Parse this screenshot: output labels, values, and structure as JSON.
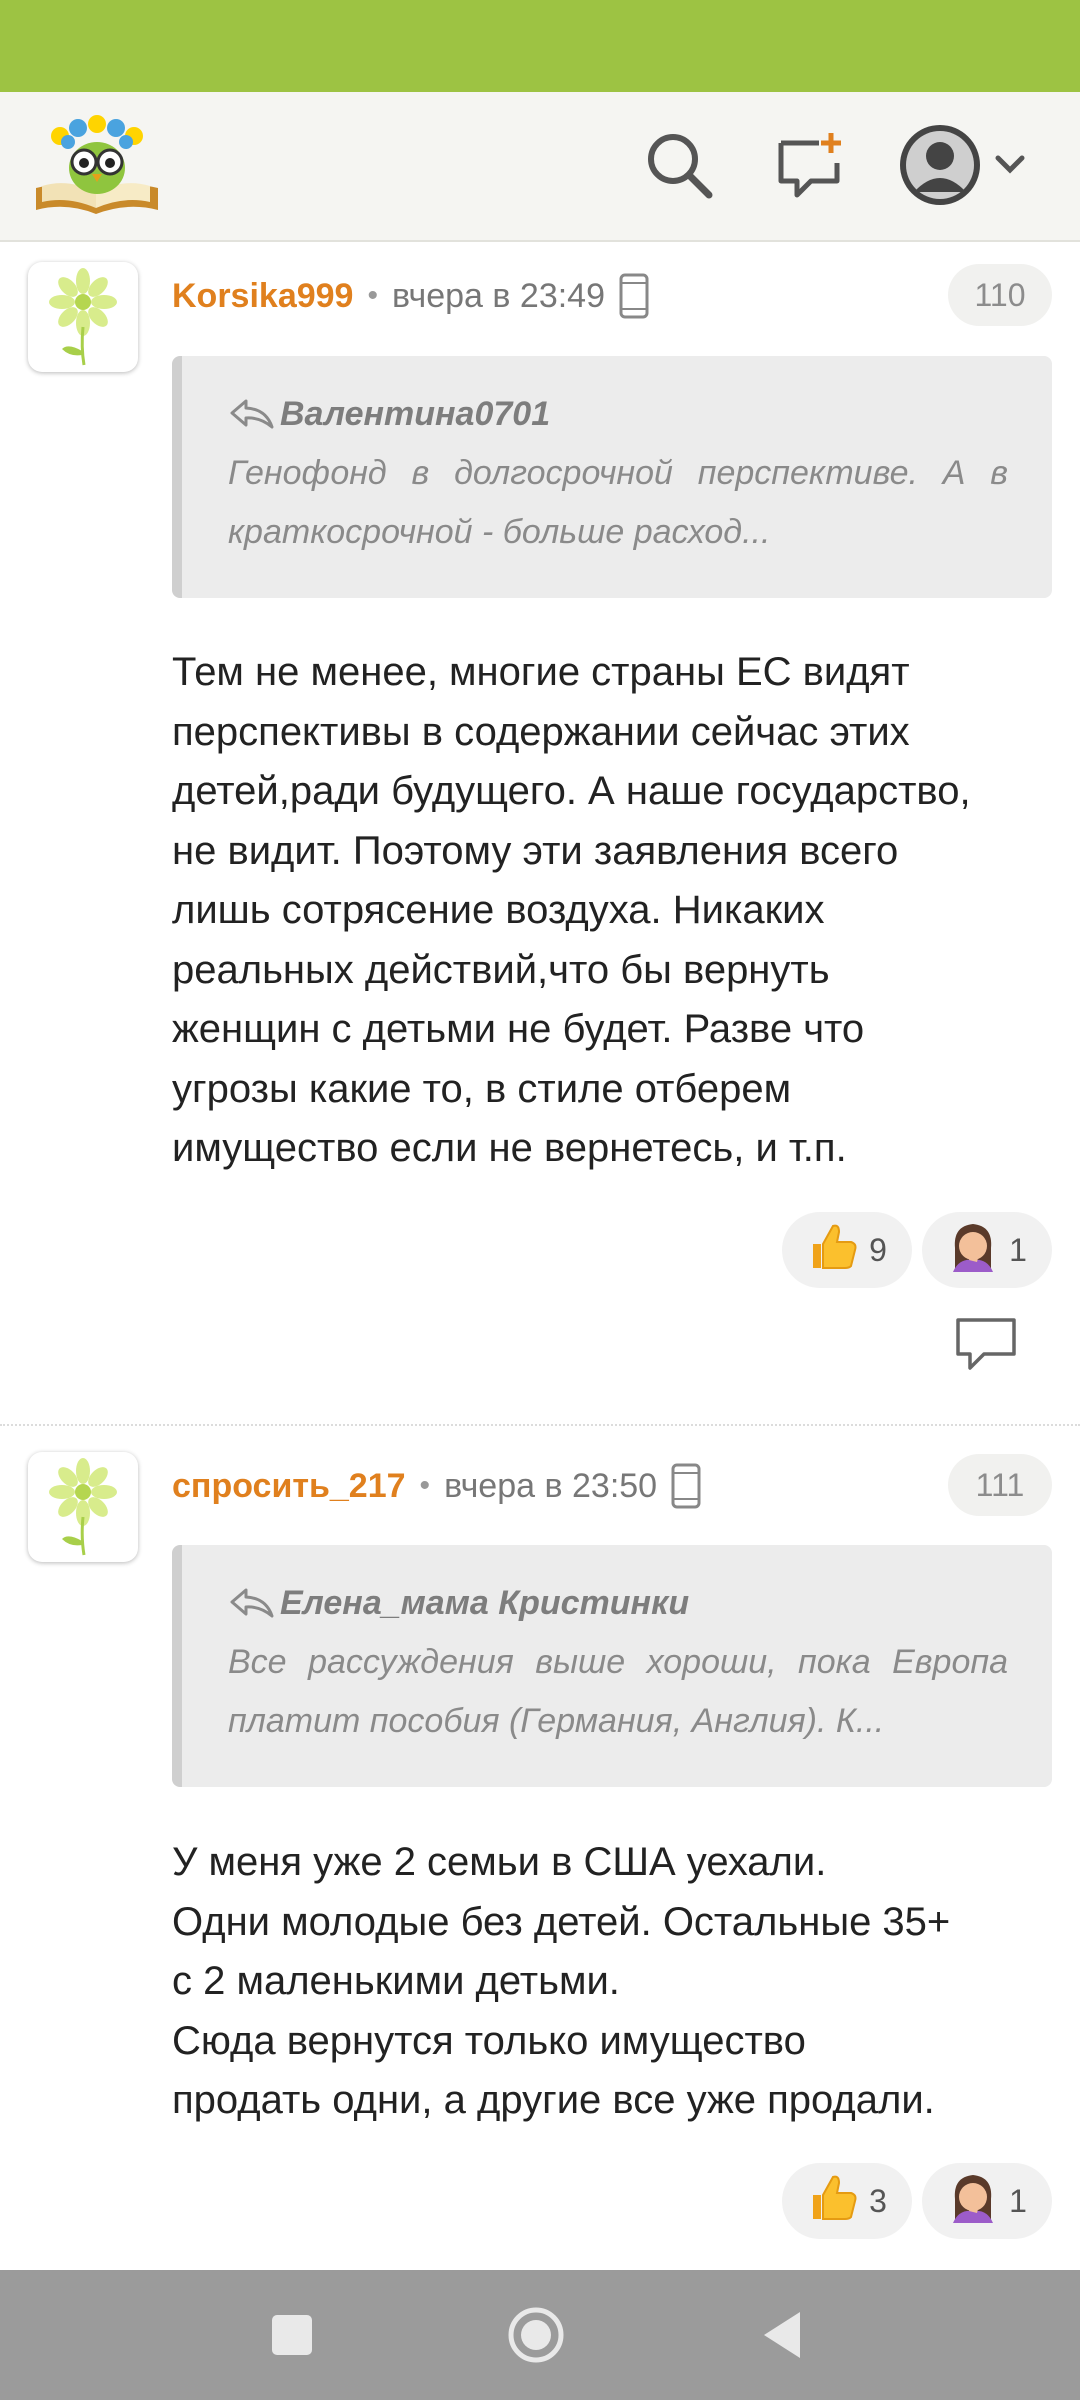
{
  "header": {
    "logo_icon": "owl-book-logo-icon",
    "search_icon": "search-icon",
    "new_post_icon": "new-message-icon",
    "profile_icon": "user-avatar-icon",
    "menu_icon": "chevron-down-icon"
  },
  "comments": [
    {
      "author": "Korsika999",
      "separator": "•",
      "time": "вчера в 23:49",
      "device_icon": "mobile-phone-icon",
      "number": "110",
      "quote": {
        "author": "Валентина0701",
        "text": "Генофонд в долгосрочной перспективе. А в краткосрочной - больше расход..."
      },
      "text_lines": [
        "Тем не менее, многие страны ЕС видят",
        "перспективы в содержании сейчас этих",
        "детей,ради будущего. А наше государство,",
        "не видит. Поэтому эти заявления всего",
        "лишь сотрясение воздуха. Никаких",
        "реальных действий,что бы вернуть",
        "женщин с детьми не будет. Разве что",
        "угрозы какие то, в стиле отберем",
        "имущество если не вернетесь, и т.п."
      ],
      "reactions": [
        {
          "icon": "thumbs-up-icon",
          "count": "9"
        },
        {
          "icon": "facepalm-icon",
          "count": "1"
        }
      ]
    },
    {
      "author": "спросить_217",
      "separator": "•",
      "time": "вчера в 23:50",
      "device_icon": "mobile-phone-icon",
      "number": "111",
      "quote": {
        "author": "Елена_мама Кристинки",
        "text": "Все рассуждения выше хороши, пока Европа платит пособия (Германия, Англия). К..."
      },
      "text_lines": [
        "У меня уже 2 семьи в США уехали.",
        "Одни молодые без детей. Остальные 35+",
        "с 2 маленькими детьми.",
        "Сюда вернутся только имущество",
        "продать одни, а другие все уже продали."
      ],
      "reactions": [
        {
          "icon": "thumbs-up-icon",
          "count": "3"
        },
        {
          "icon": "facepalm-icon",
          "count": "1"
        }
      ]
    }
  ],
  "navbar": {
    "recents_icon": "square-recents-icon",
    "home_icon": "circle-home-icon",
    "back_icon": "triangle-back-icon"
  },
  "colors": {
    "status_bar": "#9dc343",
    "author": "#e0801e",
    "navbar": "#9b9b9b"
  }
}
